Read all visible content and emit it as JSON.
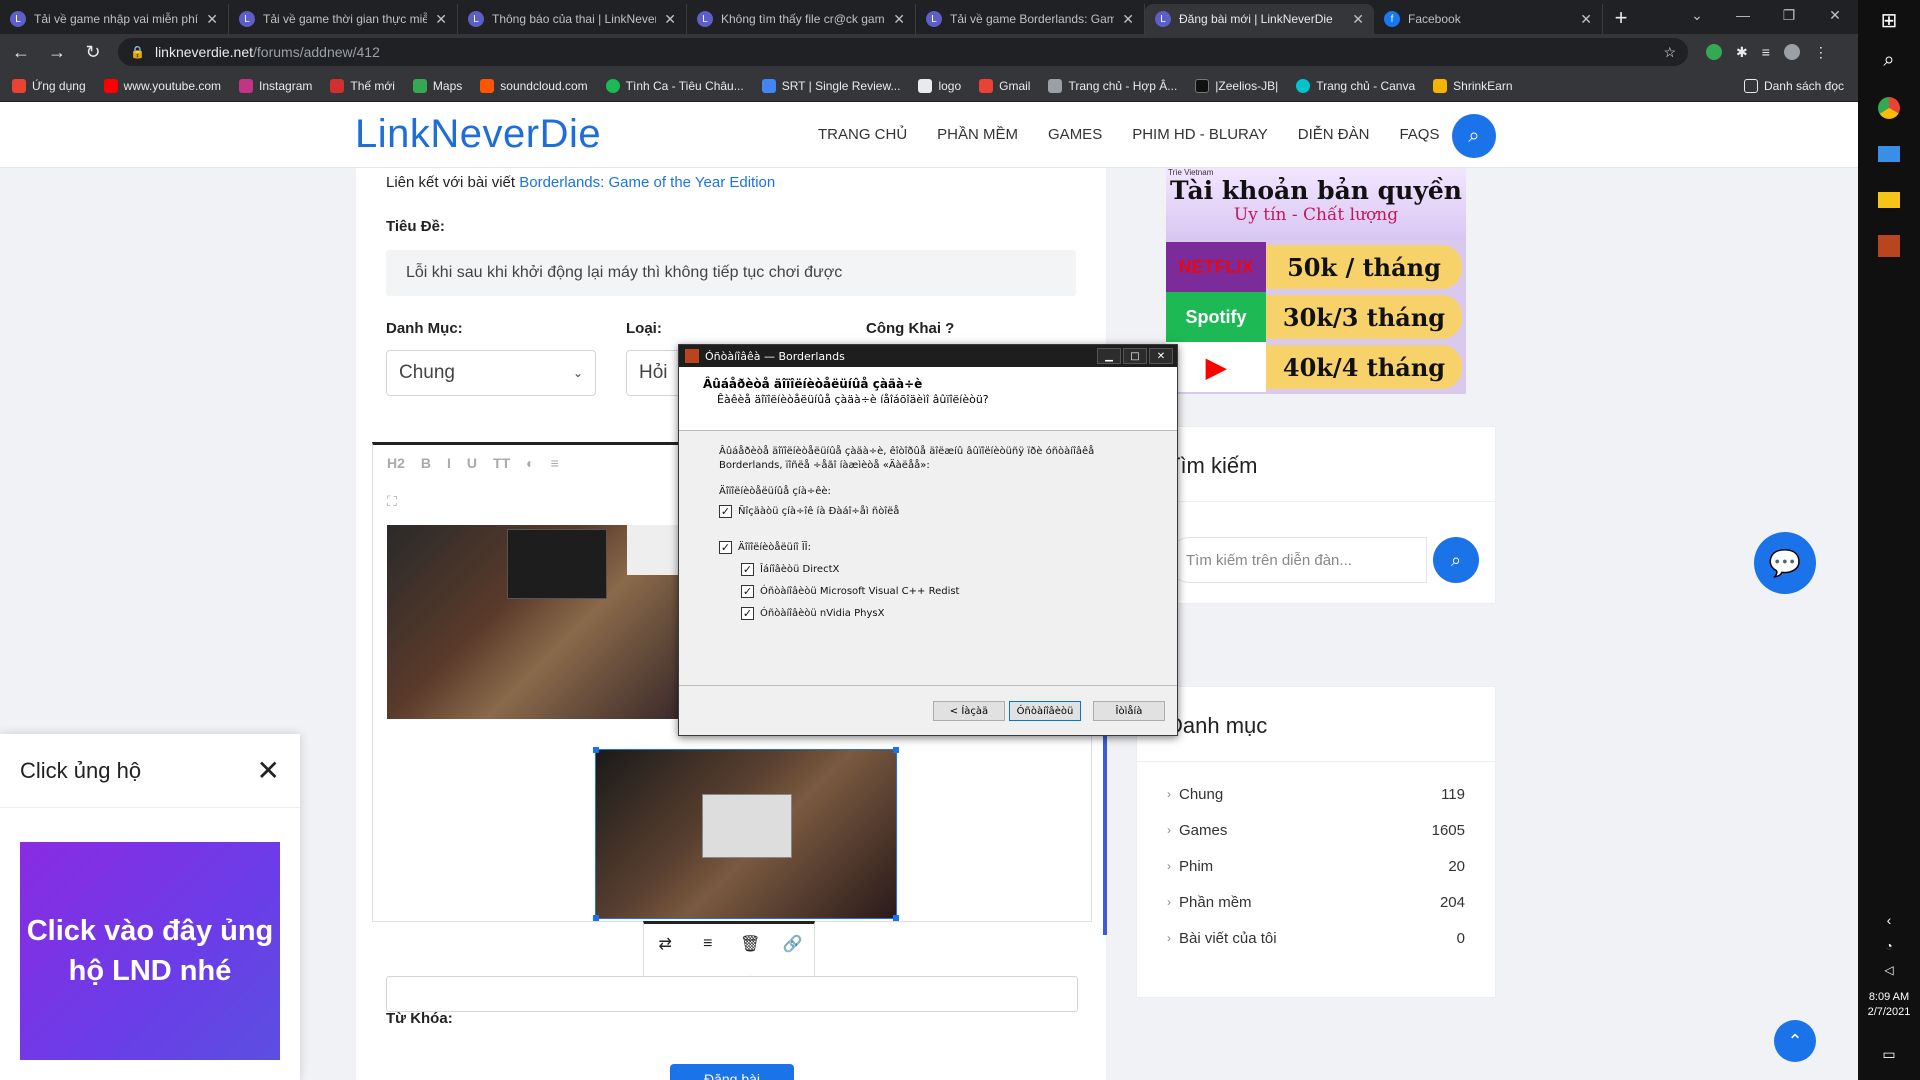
{
  "browser": {
    "tabs": [
      {
        "title": "Tải về game nhập vai miễn phí",
        "icon": "lnd-icon"
      },
      {
        "title": "Tải về game thời gian thực miễ",
        "icon": "lnd-icon"
      },
      {
        "title": "Thông báo của thai | LinkNever",
        "icon": "lnd-icon"
      },
      {
        "title": "Không tìm thấy file cr@ck gam",
        "icon": "lnd-icon"
      },
      {
        "title": "Tải về game Borderlands: Gam",
        "icon": "lnd-icon"
      },
      {
        "title": "Đăng bài mới | LinkNeverDie",
        "icon": "lnd-icon",
        "active": true
      },
      {
        "title": "Facebook",
        "icon": "facebook-icon"
      }
    ],
    "url_host": "linkneverdie.net",
    "url_path": "/forums/addnew/412",
    "bookmarks": [
      "Ứng dụng",
      "www.youtube.com",
      "Instagram",
      "Thế mới",
      "Maps",
      "soundcloud.com",
      "Tình Ca - Tiêu Châu...",
      "SRT | Single Review...",
      "logo",
      "Gmail",
      "Trang chủ - Hợp Â...",
      "|Zeelios-JB|",
      "Trang chủ - Canva",
      "ShrinkEarn"
    ],
    "reading_list": "Danh sách đọc"
  },
  "taskbar": {
    "time": "8:09 AM",
    "date": "2/7/2021"
  },
  "site": {
    "logo": "LinkNeverDie",
    "menu": [
      "TRANG CHỦ",
      "PHẦN MỀM",
      "GAMES",
      "PHIM HD - BLURAY",
      "DIỄN ĐÀN",
      "FAQS"
    ]
  },
  "form": {
    "linked_prefix": "Liên kết với bài viết",
    "linked_title": "Borderlands: Game of the Year Edition",
    "title_label": "Tiêu Đề:",
    "title_value": "Lỗi khi sau khi khởi động lại máy thì không tiếp tục chơi được",
    "category_label": "Danh Mục:",
    "category_value": "Chung",
    "type_label": "Loại:",
    "type_value": "Hỏi",
    "public_label": "Công Khai ?",
    "editor_tools": [
      "H2",
      "B",
      "I",
      "U",
      "TT",
      "◐",
      "≡"
    ],
    "keywords_label": "Từ Khóa:",
    "submit_label": "Đăng bài"
  },
  "sidebar": {
    "ad": {
      "brand_top": "Trìe Vietnam",
      "headline": "Tài khoản bản quyền",
      "subline": "Uy tín - Chất lượng",
      "rows": [
        {
          "brand": "NETFLIX",
          "price": "50k / tháng"
        },
        {
          "brand": "Spotify",
          "price": "30k/3 tháng"
        },
        {
          "brand": "▶",
          "price": "40k/4 tháng"
        }
      ]
    },
    "search_title": "Tìm kiếm",
    "search_placeholder": "Tìm kiếm trên diễn đàn...",
    "categories_title": "Danh mục",
    "categories": [
      {
        "name": "Chung",
        "count": "119"
      },
      {
        "name": "Games",
        "count": "1605"
      },
      {
        "name": "Phim",
        "count": "20"
      },
      {
        "name": "Phần mềm",
        "count": "204"
      },
      {
        "name": "Bài viết của tôi",
        "count": "0"
      }
    ]
  },
  "donate": {
    "title": "Click ủng hộ",
    "banner": "Click vào đây ủng hộ LND nhé"
  },
  "dialog": {
    "title": "Óñòàíîâêà — Borderlands",
    "heading": "Âûáåðèòå äîïîëíèòåëüíûå çàäà÷è",
    "subheading": "Êàêèå äîïîëíèòåëüíûå çàäà÷è íåîáõîäèìî âûïîëíèòü?",
    "description": "Âûáåðèòå äîïîëíèòåëüíûå çàäà÷è, êîòîðûå äîëæíû âûïîëíèòüñÿ ïðè óñòàíîâêå Borderlands, ïîñëå ÷åãî íàæìèòå «Äàëåå»:",
    "group1": "Äîïîëíèòåëüíûå çíà÷êè:",
    "opt1": "Ñîçäàòü çíà÷îê íà Ðàáî÷åì ñòîëå",
    "group2": "Äîïîëíèòåëüíî ÏÎ:",
    "opt2": "Îáíîâèòü DirectX",
    "opt3": "Óñòàíîâèòü Microsoft Visual C++ Redist",
    "opt4": "Óñòàíîâèòü nVidia PhysX",
    "back": "< Íàçàä",
    "install": "Óñòàíîâèòü",
    "cancel": "Îòìåíà"
  }
}
